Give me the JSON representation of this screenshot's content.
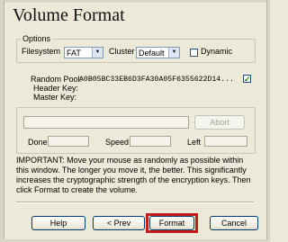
{
  "dialog": {
    "title": "Volume Format"
  },
  "options": {
    "legend": "Options",
    "filesystem_label": "Filesystem",
    "filesystem_value": "FAT",
    "cluster_label": "Cluster",
    "cluster_value": "Default",
    "dynamic_label": "Dynamic",
    "dynamic_checked": false
  },
  "keys": {
    "random_pool_label": "Random Pool:",
    "random_pool_value": "A0B05BC33EB6D3FA30A05F6355622D14...",
    "show_keys_checked": true,
    "header_key_label": "Header Key:",
    "master_key_label": "Master Key:"
  },
  "progress": {
    "abort_label": "Abort",
    "done_label": "Done",
    "speed_label": "Speed",
    "left_label": "Left",
    "fraction": 0
  },
  "instructions": {
    "text": "IMPORTANT: Move your mouse as randomly as possible within this window. The longer you move it, the better. This significantly increases the cryptographic strength of the encryption keys. Then click Format to create the volume."
  },
  "buttons": {
    "help_label": "Help",
    "prev_label": "< Prev",
    "format_label": "Format",
    "cancel_label": "Cancel"
  },
  "colors": {
    "window_bg": "#ece9d8",
    "highlight": "#c41b1b",
    "button_border": "#003c74"
  },
  "icons": {
    "dropdown": "chevron-down-icon",
    "checkmark": "checkmark-icon"
  }
}
